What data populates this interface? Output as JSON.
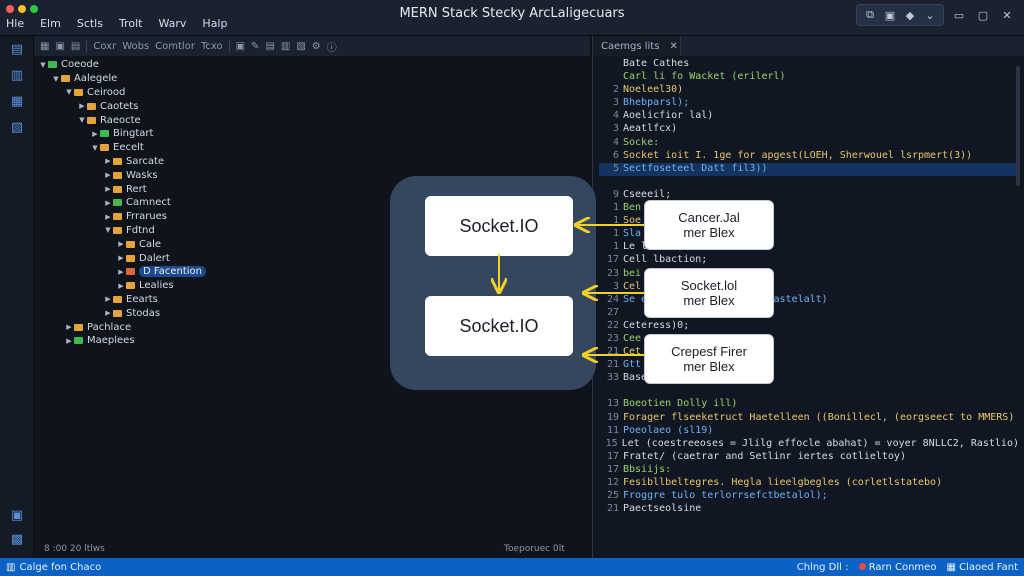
{
  "window": {
    "title": "MERN Stack Stecky ArcLaligecuars",
    "menu": [
      "Hle",
      "Elm",
      "Sctls",
      "Trolt",
      "Warv",
      "Halp"
    ]
  },
  "activity_icons": [
    "files-icon",
    "search-icon",
    "source-control-icon",
    "extensions-icon"
  ],
  "explorer": {
    "toolbar": [
      "Coxr",
      "Wobs",
      "Comtlor",
      "Tcxo"
    ],
    "tree": [
      {
        "label": "Coeode",
        "indent": 0,
        "open": true
      },
      {
        "label": "Aalegele",
        "indent": 1,
        "open": true
      },
      {
        "label": "Ceirood",
        "indent": 2,
        "open": true
      },
      {
        "label": "Caotets",
        "indent": 3,
        "open": false
      },
      {
        "label": "Raeocte",
        "indent": 3,
        "open": true
      },
      {
        "label": "Bingtart",
        "indent": 4,
        "open": false
      },
      {
        "label": "Eecelt",
        "indent": 4,
        "open": true
      },
      {
        "label": "Sarcate",
        "indent": 5,
        "open": false
      },
      {
        "label": "Wasks",
        "indent": 5,
        "open": false
      },
      {
        "label": "Rert",
        "indent": 5,
        "open": false
      },
      {
        "label": "Camnect",
        "indent": 5,
        "open": false
      },
      {
        "label": "Frrarues",
        "indent": 5,
        "open": false
      },
      {
        "label": "Fdtnd",
        "indent": 5,
        "open": true
      },
      {
        "label": "Cale",
        "indent": 6,
        "open": false
      },
      {
        "label": "Dalert",
        "indent": 6,
        "open": false
      },
      {
        "label": "D Facention",
        "indent": 6,
        "open": false,
        "selected": true
      },
      {
        "label": "Lealies",
        "indent": 6,
        "open": false
      },
      {
        "label": "Eearts",
        "indent": 5,
        "open": false
      },
      {
        "label": "Stodas",
        "indent": 5,
        "open": false
      },
      {
        "label": "Pachlace",
        "indent": 2,
        "open": false
      },
      {
        "label": "Maeplees",
        "indent": 2,
        "open": false
      }
    ],
    "status_left": "8 :00 20 ltlws",
    "status_right": "Toeporuec 0lt"
  },
  "diagram": {
    "node_top": "Socket.IO",
    "node_bottom": "Socket.IO",
    "side_nodes": [
      "Cancer.Jal\nmer Blex",
      "Socket.lol\nmer Blex",
      "Crepesf Firer\nmer Blex"
    ]
  },
  "editor": {
    "tab": "Caemgs lits",
    "lines": [
      {
        "ln": "",
        "t": "Bate Cathes"
      },
      {
        "ln": "",
        "t": "Carl li fo Wacket (erilerl)"
      },
      {
        "ln": "2",
        "t": "Noeleel30)"
      },
      {
        "ln": "3",
        "t": "Bhebparsl);"
      },
      {
        "ln": "4",
        "t": "Aoelicfior lal)"
      },
      {
        "ln": "3",
        "t": "Aeatlfcx)"
      },
      {
        "ln": "4",
        "t": "Socke:"
      },
      {
        "ln": "6",
        "t": "Socket ioit I. 1ge for apgest(LOEH, Sherwouel lsrpmert(3))"
      },
      {
        "ln": "5",
        "t": "Sectfoseteel Datt fil3))",
        "hl": true
      },
      {
        "ln": "",
        "t": ""
      },
      {
        "ln": "9",
        "t": "Cseeeil;"
      },
      {
        "ln": "1",
        "t": "Ben"
      },
      {
        "ln": "1",
        "t": "Soe"
      },
      {
        "ln": "1",
        "t": "Sla"
      },
      {
        "ln": "1",
        "t": "Le                         lect(l)"
      },
      {
        "ln": "17",
        "t": "Cell lbaction;"
      },
      {
        "ln": "23",
        "t": "bei"
      },
      {
        "ln": "3",
        "t": "Cel"
      },
      {
        "ln": "24",
        "t": "Se                         erare for Berlictor, Rastelalt)"
      },
      {
        "ln": "27",
        "t": ""
      },
      {
        "ln": "22",
        "t": "Ceteress)0;"
      },
      {
        "ln": "23",
        "t": "Cee"
      },
      {
        "ln": "21",
        "t": "Cet"
      },
      {
        "ln": "21",
        "t": "Gtt"
      },
      {
        "ln": "33",
        "t": "Baseegtl, Sahaet(lal)"
      },
      {
        "ln": "",
        "t": ""
      },
      {
        "ln": "13",
        "t": "Boeotien Dolly ill)"
      },
      {
        "ln": "19",
        "t": "Forager flseeketruct Haetelleen ((Bonillecl, (eorgseect to MMERS)"
      },
      {
        "ln": "11",
        "t": "Poeolaeo (sl19)"
      },
      {
        "ln": "15",
        "t": "Let (coestreeoses = Jlilg effocle abahat) = voyer 8NLLC2, Rastlio)"
      },
      {
        "ln": "17",
        "t": "Fratet/ (caetrar and Setlinr iertes cotlieltoy)"
      },
      {
        "ln": "17",
        "t": "Bbsiijs:"
      },
      {
        "ln": "12",
        "t": "Fesibllbeltegres. Hegla lieelgbegles (corletlstatebo)"
      },
      {
        "ln": "25",
        "t": "Froggre tulo terlorrsefctbetalol);"
      },
      {
        "ln": "21",
        "t": "Paectseolsine"
      }
    ]
  },
  "statusbar": {
    "left": "Calge fon Chaco",
    "right": [
      "Chlng Dll :",
      "Rarn Conmeo",
      "Claoed Fant"
    ]
  },
  "colors": {
    "accent": "#0b62c4",
    "diagram_bg": "#34475e",
    "arrow": "#f2d024",
    "selection": "#1d4a8a"
  }
}
